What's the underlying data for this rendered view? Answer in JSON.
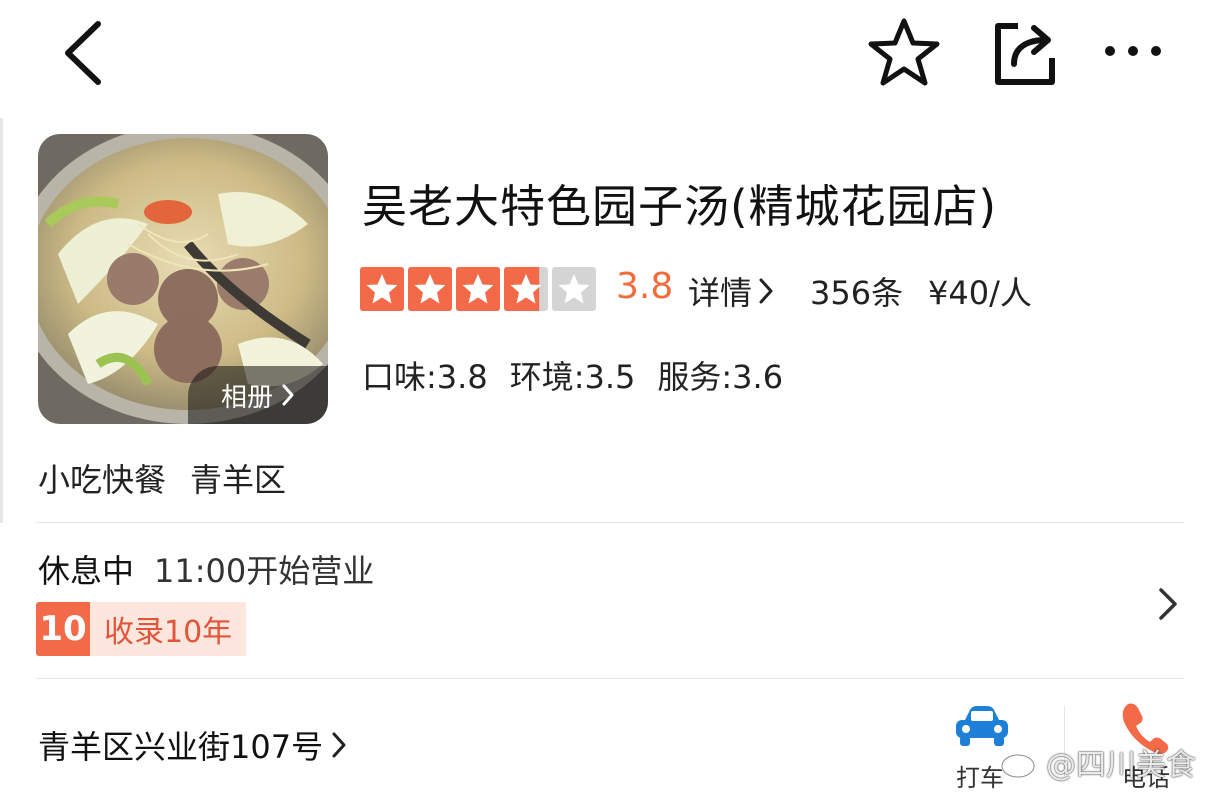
{
  "shop": {
    "name": "吴老大特色园子汤(精城花园店)",
    "rating": "3.8",
    "rating_value": 3.8,
    "rating_max": 5,
    "detail_label": "详情",
    "review_count": "356条",
    "avg_price": "¥40/人",
    "sub_scores": [
      "口味:3.8",
      "环境:3.5",
      "服务:3.6"
    ],
    "category": "小吃快餐",
    "district": "青羊区",
    "album_label": "相册"
  },
  "status": {
    "state": "休息中",
    "hours": "11:00开始营业",
    "badge_number": "10",
    "badge_text": "收录10年"
  },
  "address": {
    "text": "青羊区兴业街107号"
  },
  "actions": {
    "taxi_label": "打车",
    "phone_label": "电话"
  },
  "watermark": {
    "text": "@四川美食"
  },
  "icons": [
    "back-arrow-icon",
    "favorite-star-icon",
    "share-icon",
    "more-icon",
    "chevron-right-icon",
    "car-icon",
    "phone-icon",
    "weibo-icon"
  ],
  "colors": {
    "accent": "#f26c3b",
    "star_on": "#f26a47",
    "star_off": "#d4d4d4",
    "badge_bg": "#fde6dd",
    "taxi_blue": "#1e7fd8"
  }
}
